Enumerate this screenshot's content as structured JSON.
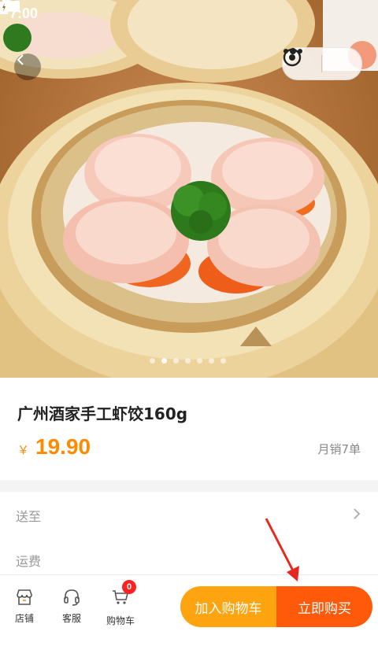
{
  "status_bar": {
    "time": "7:00"
  },
  "product": {
    "title": "广州酒家手工虾饺160g",
    "currency": "￥",
    "price": "19.90",
    "sales": "月销7单"
  },
  "carousel": {
    "total": 7,
    "active_index": 1
  },
  "shipping": {
    "deliver_to_label": "送至",
    "freight_label": "运费"
  },
  "bottom_nav": {
    "store_label": "店铺",
    "service_label": "客服",
    "cart_label": "购物车",
    "cart_count": "0"
  },
  "actions": {
    "add_to_cart": "加入购物车",
    "buy_now": "立即购买"
  },
  "colors": {
    "accent_orange": "#ffa411",
    "buy_red": "#ff5a0a",
    "price": "#ff8a00",
    "badge": "#ff2222"
  }
}
